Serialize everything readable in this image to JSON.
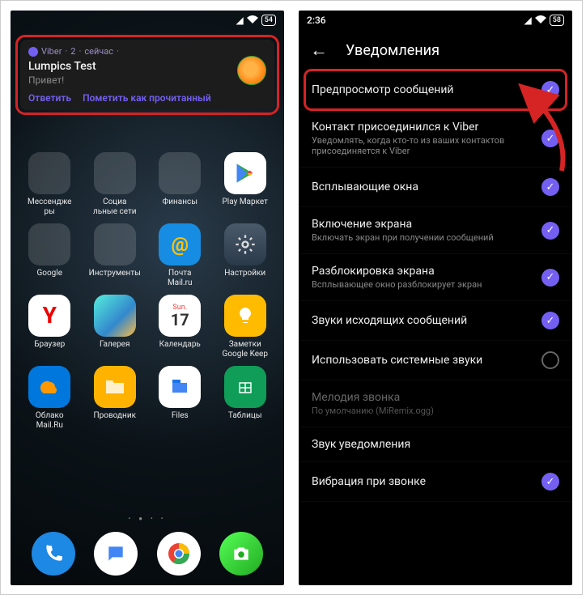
{
  "left": {
    "statusbar": {
      "battery": "54"
    },
    "notification": {
      "app": "Viber",
      "count": "2",
      "time": "сейчас",
      "title": "Lumpics Test",
      "message": "Привет!",
      "reply": "Ответить",
      "mark_read": "Пометить как прочитанный"
    },
    "apps": [
      {
        "label": "Мессендже\nры"
      },
      {
        "label": "Социа\nльные сети"
      },
      {
        "label": "Финансы"
      },
      {
        "label": "Play Маркет"
      },
      {
        "label": "Google"
      },
      {
        "label": "Инструменты"
      },
      {
        "label": "Почта\nMail.ru"
      },
      {
        "label": "Настройки"
      },
      {
        "label": "Браузер"
      },
      {
        "label": "Галерея"
      },
      {
        "label": "Календарь"
      },
      {
        "label": "Заметки\nGoogle Keep"
      },
      {
        "label": "Облако\nMail.Ru"
      },
      {
        "label": "Проводник"
      },
      {
        "label": "Files"
      },
      {
        "label": "Таблицы"
      }
    ],
    "calendar": {
      "day_name": "Sun.",
      "day_num": "17"
    }
  },
  "right": {
    "statusbar": {
      "time": "2:36",
      "battery": "58"
    },
    "header": "Уведомления",
    "settings": [
      {
        "label": "Предпросмотр сообщений",
        "sub": "",
        "checked": true,
        "highlight": true
      },
      {
        "label": "Контакт присоединился к Viber",
        "sub": "Уведомлять, когда кто-то из ваших контактов присоединяется к Viber",
        "checked": true
      },
      {
        "label": "Всплывающие окна",
        "sub": "",
        "checked": true
      },
      {
        "label": "Включение экрана",
        "sub": "Включать экран при получении сообщений",
        "checked": true
      },
      {
        "label": "Разблокировка экрана",
        "sub": "Всплывающее окно разблокирует экран",
        "checked": true
      },
      {
        "label": "Звуки исходящих сообщений",
        "sub": "",
        "checked": true
      },
      {
        "label": "Использовать системные звуки",
        "sub": "",
        "checked": false
      },
      {
        "label": "Мелодия звонка",
        "sub": "По умолчанию (MiRemix.ogg)",
        "disabled": true
      },
      {
        "label": "Звук уведомления",
        "sub": ""
      },
      {
        "label": "Вибрация при звонке",
        "sub": "",
        "checked": true
      }
    ]
  }
}
